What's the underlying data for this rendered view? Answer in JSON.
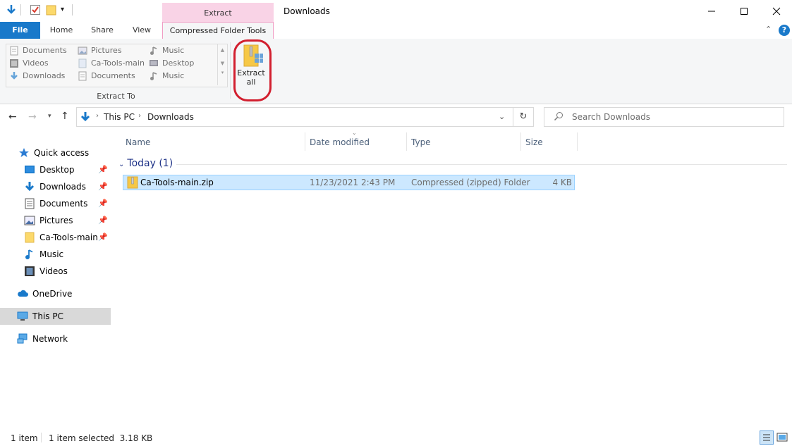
{
  "window": {
    "title": "Downloads",
    "minimize": "—",
    "maximize": "☐",
    "close": "✕"
  },
  "ribbon_tabs": {
    "file": "File",
    "home": "Home",
    "share": "Share",
    "view": "View",
    "compressed": "Compressed Folder Tools",
    "context_header": "Extract"
  },
  "extract_to": {
    "col1": [
      "Documents",
      "Videos",
      "Downloads"
    ],
    "col2": [
      "Pictures",
      "Ca-Tools-main",
      "Documents"
    ],
    "col3": [
      "Music",
      "Desktop",
      "Music"
    ],
    "group_label": "Extract To"
  },
  "extract_all": {
    "label_line1": "Extract",
    "label_line2": "all"
  },
  "address": {
    "segments": [
      "This PC",
      "Downloads"
    ]
  },
  "search": {
    "placeholder": "Search Downloads"
  },
  "nav": {
    "quick_access": "Quick access",
    "items": [
      "Desktop",
      "Downloads",
      "Documents",
      "Pictures",
      "Ca-Tools-main",
      "Music",
      "Videos"
    ],
    "onedrive": "OneDrive",
    "thispc": "This PC",
    "network": "Network"
  },
  "columns": {
    "name": "Name",
    "date": "Date modified",
    "type": "Type",
    "size": "Size"
  },
  "group": {
    "label": "Today (1)"
  },
  "files": [
    {
      "name": "Ca-Tools-main.zip",
      "date": "11/23/2021 2:43 PM",
      "type": "Compressed (zipped) Folder",
      "size": "4 KB"
    }
  ],
  "status": {
    "count": "1 item",
    "selected": "1 item selected  3.18 KB"
  },
  "colors": {
    "accent": "#1979ca",
    "context": "#f9d3e6",
    "highlight": "#d21f2f",
    "selection": "#cce8ff"
  }
}
